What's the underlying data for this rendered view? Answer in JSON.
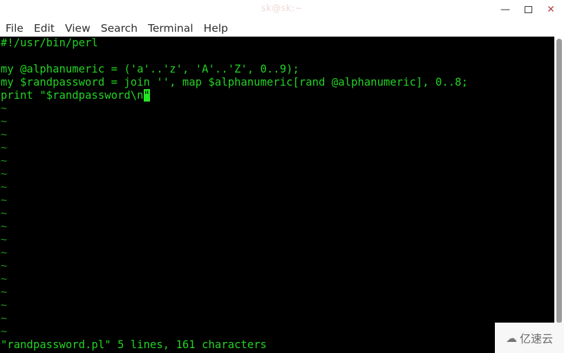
{
  "window": {
    "title": "sk@sk:~",
    "controls": {
      "minimize": "minimize-icon",
      "maximize": "maximize-icon",
      "close": "close-icon"
    }
  },
  "menubar": {
    "items": [
      "File",
      "Edit",
      "View",
      "Search",
      "Terminal",
      "Help"
    ]
  },
  "editor": {
    "lines": [
      "#!/usr/bin/perl",
      "",
      "my @alphanumeric = ('a'..'z', 'A'..'Z', 0..9);",
      "my $randpassword = join '', map $alphanumeric[rand @alphanumeric], 0..8;",
      "print \"$randpassword\\n"
    ],
    "cursor_char": "\"",
    "empty_line_marker": "~",
    "empty_line_count": 18,
    "status_line": "\"randpassword.pl\" 5 lines, 161 characters"
  },
  "watermark": {
    "icon": "cloud-logo-icon",
    "text": "亿速云"
  },
  "colors": {
    "text": "#22d322",
    "tilde": "#1a8f1a",
    "background": "#000000",
    "cursor": "#22e822"
  }
}
